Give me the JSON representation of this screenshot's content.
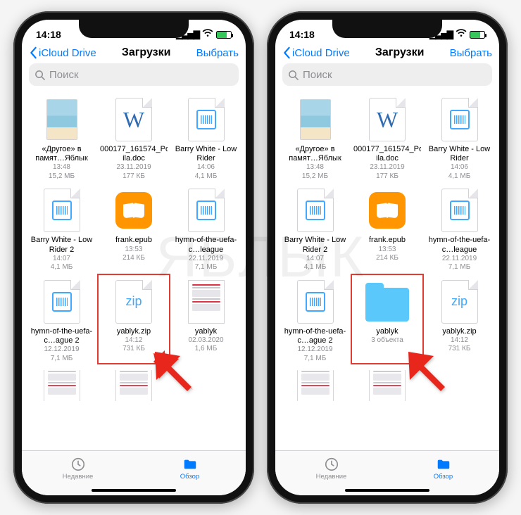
{
  "watermark": "ЯБЛЫК",
  "status": {
    "time": "14:18"
  },
  "nav": {
    "back": "iCloud Drive",
    "title": "Загрузки",
    "action": "Выбрать"
  },
  "search": {
    "placeholder": "Поиск"
  },
  "tabs": {
    "recent": "Недавние",
    "browse": "Обзор"
  },
  "left": {
    "files": [
      {
        "name": "«Другое» в памят…Яблык",
        "line1": "13:48",
        "line2": "15,2 МБ",
        "type": "image"
      },
      {
        "name": "000177_161574_Post-…ila.doc",
        "line1": "23.11.2019",
        "line2": "177 КБ",
        "type": "word"
      },
      {
        "name": "Barry White - Low Rider",
        "line1": "14:06",
        "line2": "4,1 МБ",
        "type": "audio"
      },
      {
        "name": "Barry White - Low Rider 2",
        "line1": "14:07",
        "line2": "4,1 МБ",
        "type": "audio"
      },
      {
        "name": "frank.epub",
        "line1": "13:53",
        "line2": "214 КБ",
        "type": "book"
      },
      {
        "name": "hymn-of-the-uefa-c…league",
        "line1": "22.11.2019",
        "line2": "7,1 МБ",
        "type": "audio",
        "cloud": true
      },
      {
        "name": "hymn-of-the-uefa-c…ague 2",
        "line1": "12.12.2019",
        "line2": "7,1 МБ",
        "type": "audio",
        "cloud": true
      },
      {
        "name": "yablyk.zip",
        "line1": "14:12",
        "line2": "731 КБ",
        "type": "zip",
        "highlight": true
      },
      {
        "name": "yablyk",
        "line1": "02.03.2020",
        "line2": "1,6 МБ",
        "type": "doc"
      }
    ],
    "partial": [
      {
        "type": "doc"
      },
      {
        "type": "doc"
      }
    ]
  },
  "right": {
    "files": [
      {
        "name": "«Другое» в памят…Яблык",
        "line1": "13:48",
        "line2": "15,2 МБ",
        "type": "image"
      },
      {
        "name": "000177_161574_Post-…ila.doc",
        "line1": "23.11.2019",
        "line2": "177 КБ",
        "type": "word"
      },
      {
        "name": "Barry White - Low Rider",
        "line1": "14:06",
        "line2": "4,1 МБ",
        "type": "audio"
      },
      {
        "name": "Barry White - Low Rider 2",
        "line1": "14:07",
        "line2": "4,1 МБ",
        "type": "audio"
      },
      {
        "name": "frank.epub",
        "line1": "13:53",
        "line2": "214 КБ",
        "type": "book"
      },
      {
        "name": "hymn-of-the-uefa-c…league",
        "line1": "22.11.2019",
        "line2": "7,1 МБ",
        "type": "audio",
        "cloud": true
      },
      {
        "name": "hymn-of-the-uefa-c…ague 2",
        "line1": "12.12.2019",
        "line2": "7,1 МБ",
        "type": "audio",
        "cloud": true
      },
      {
        "name": "yablyk",
        "line1": "3 объекта",
        "line2": "",
        "type": "folder",
        "highlight": true
      },
      {
        "name": "yablyk.zip",
        "line1": "14:12",
        "line2": "731 КБ",
        "type": "zip"
      }
    ],
    "partial": [
      {
        "type": "doc"
      },
      {
        "type": "doc"
      }
    ]
  }
}
